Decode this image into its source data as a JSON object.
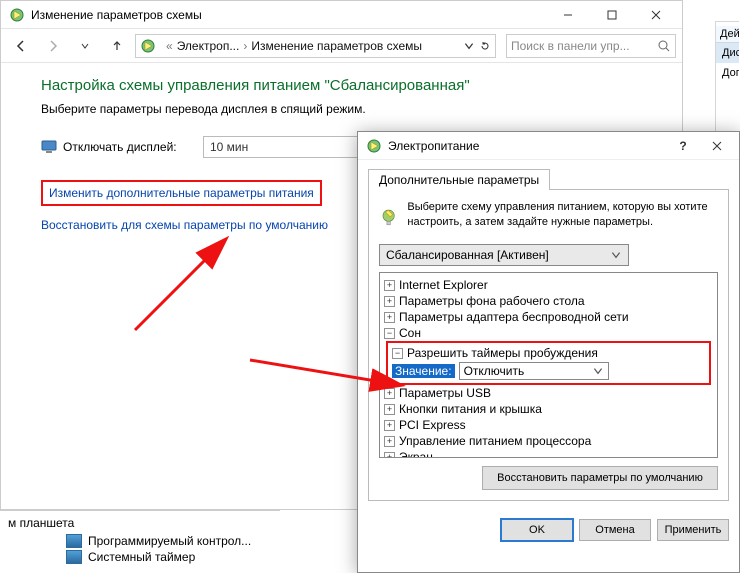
{
  "win1": {
    "title": "Изменение параметров схемы",
    "nav": {
      "crumb1": "Электроп...",
      "crumb2": "Изменение параметров схемы"
    },
    "search_placeholder": "Поиск в панели упр...",
    "heading": "Настройка схемы управления питанием \"Сбалансированная\"",
    "subtext": "Выберите параметры перевода дисплея в спящий режим.",
    "display_off_label": "Отключать дисплей:",
    "display_off_value": "10 мин",
    "link_advanced": "Изменить дополнительные параметры питания",
    "link_restore": "Восстановить для схемы параметры по умолчанию"
  },
  "actions": {
    "header": "Действия",
    "item1": "Диспетч",
    "item2": "Доп"
  },
  "bottom": {
    "tablet": "м планшета",
    "task1": "Программируемый контрол...",
    "task2": "Системный таймер"
  },
  "dlg": {
    "title": "Электропитание",
    "tab": "Дополнительные параметры",
    "intro": "Выберите схему управления питанием, которую вы хотите настроить, а затем задайте нужные параметры.",
    "plan_value": "Сбалансированная [Активен]",
    "tree": {
      "n1": "Internet Explorer",
      "n2": "Параметры фона рабочего стола",
      "n3": "Параметры адаптера беспроводной сети",
      "n4": "Сон",
      "n4a": "Разрешить таймеры пробуждения",
      "n4a_value_label": "Значение:",
      "n4a_value": "Отключить",
      "n5": "Параметры USB",
      "n6": "Кнопки питания и крышка",
      "n7": "PCI Express",
      "n8": "Управление питанием процессора",
      "n9": "Экран"
    },
    "restore_defaults": "Восстановить параметры по умолчанию",
    "ok": "OK",
    "cancel": "Отмена",
    "apply": "Применить"
  }
}
